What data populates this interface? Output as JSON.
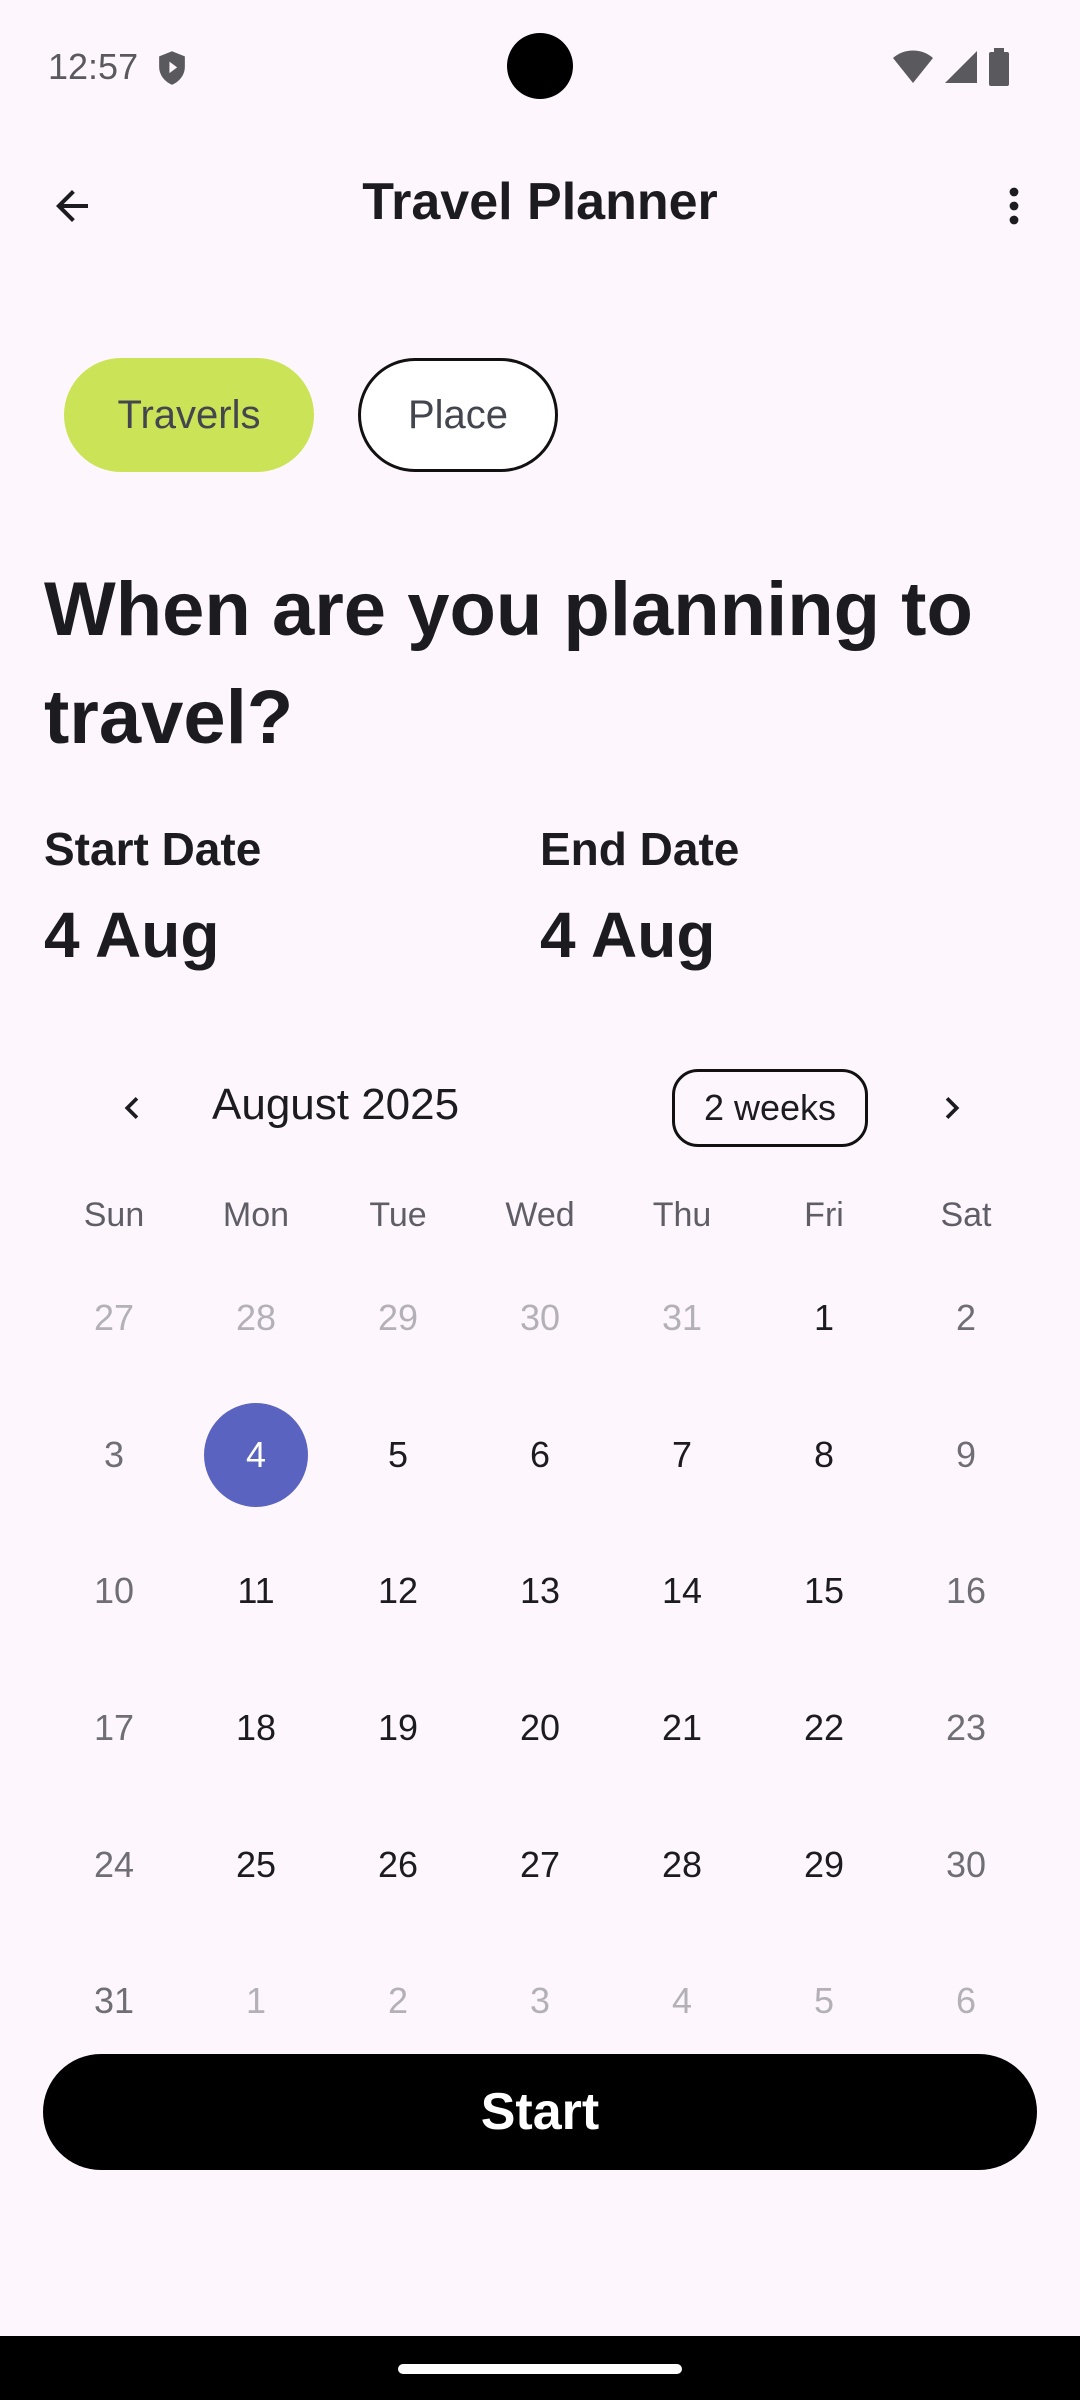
{
  "status_bar": {
    "time": "12:57",
    "icons": [
      "shield-icon",
      "wifi-icon",
      "signal-icon",
      "battery-icon"
    ]
  },
  "app_bar": {
    "title": "Travel Planner",
    "back_icon": "arrow-back-icon",
    "menu_icon": "more-vert-icon"
  },
  "chips": {
    "travels": "Traverls",
    "place": "Place"
  },
  "heading": "When are you planning to travel?",
  "dates": {
    "start_label": "Start Date",
    "start_value": "4 Aug",
    "end_label": "End Date",
    "end_value": "4 Aug"
  },
  "calendar": {
    "month": "August 2025",
    "range": "2 weeks",
    "weekdays": [
      "Sun",
      "Mon",
      "Tue",
      "Wed",
      "Thu",
      "Fri",
      "Sat"
    ],
    "weeks": [
      [
        "27",
        "28",
        "29",
        "30",
        "31",
        "1",
        "2"
      ],
      [
        "3",
        "4",
        "5",
        "6",
        "7",
        "8",
        "9"
      ],
      [
        "10",
        "11",
        "12",
        "13",
        "14",
        "15",
        "16"
      ],
      [
        "17",
        "18",
        "19",
        "20",
        "21",
        "22",
        "23"
      ],
      [
        "24",
        "25",
        "26",
        "27",
        "28",
        "29",
        "30"
      ],
      [
        "31",
        "1",
        "2",
        "3",
        "4",
        "5",
        "6"
      ]
    ],
    "selected_day": "4"
  },
  "start_button": "Start",
  "colors": {
    "background": "#FDF7FD",
    "chip_active": "#CBE356",
    "selected_day": "#5B63C0",
    "button": "#000000"
  }
}
